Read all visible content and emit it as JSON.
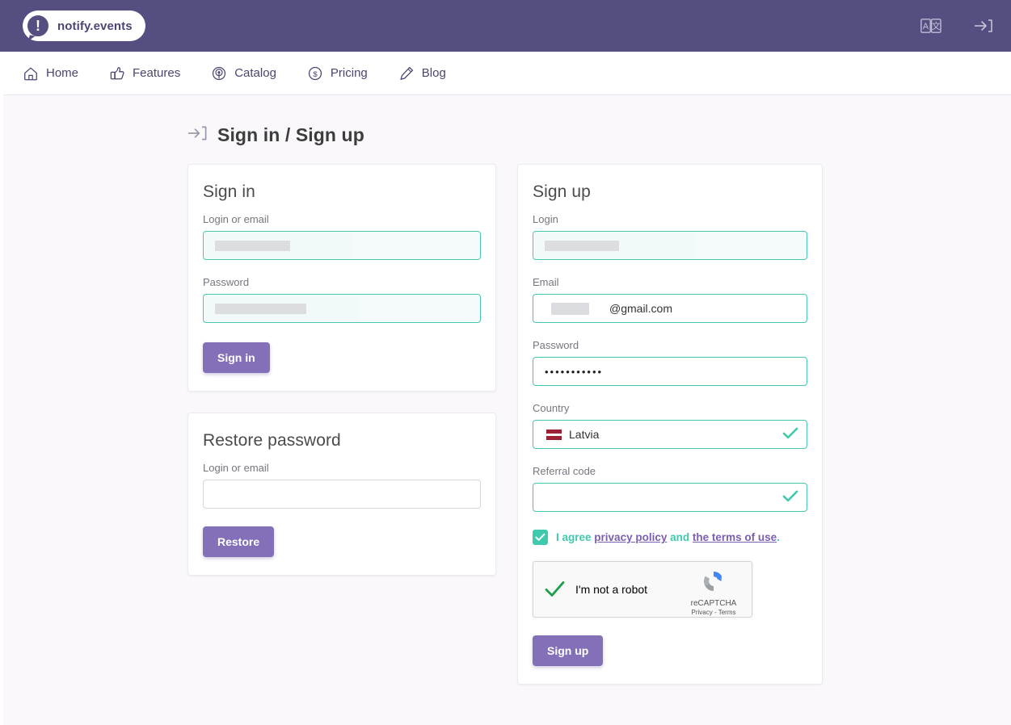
{
  "brand": {
    "name": "notify.events",
    "mark": "!"
  },
  "topbar": {
    "language_icon": "translate-icon",
    "signin_icon": "sign-in-icon"
  },
  "nav": {
    "items": [
      {
        "label": "Home",
        "icon": "home-icon"
      },
      {
        "label": "Features",
        "icon": "thumbs-up-icon"
      },
      {
        "label": "Catalog",
        "icon": "broadcast-icon"
      },
      {
        "label": "Pricing",
        "icon": "dollar-circle-icon"
      },
      {
        "label": "Blog",
        "icon": "pen-icon"
      }
    ]
  },
  "page": {
    "title": "Sign in / Sign up",
    "title_icon": "sign-in-icon"
  },
  "signin": {
    "title": "Sign in",
    "login_label": "Login or email",
    "login_value": "",
    "password_label": "Password",
    "password_value": "",
    "submit_label": "Sign in"
  },
  "restore": {
    "title": "Restore password",
    "login_label": "Login or email",
    "login_value": "",
    "login_placeholder": "",
    "submit_label": "Restore"
  },
  "signup": {
    "title": "Sign up",
    "login_label": "Login",
    "login_value": "",
    "email_label": "Email",
    "email_suffix": "@gmail.com",
    "password_label": "Password",
    "password_value": "•••••••••••",
    "country_label": "Country",
    "country_value": "Latvia",
    "country_flag": "latvia-flag",
    "referral_label": "Referral code",
    "referral_value": "",
    "agree_prefix": "I agree",
    "agree_link_privacy": "privacy policy",
    "agree_middle": "and",
    "agree_link_terms": "the terms of use",
    "agree_suffix": ".",
    "agree_checked": true,
    "submit_label": "Sign up"
  },
  "recaptcha": {
    "label": "I'm not a robot",
    "brand": "reCAPTCHA",
    "legal": "Privacy - Terms",
    "verified": true
  },
  "colors": {
    "header": "#544f80",
    "accent_purple": "#8370b8",
    "accent_teal": "#3fc9ad",
    "page_bg": "#faf8fb"
  }
}
